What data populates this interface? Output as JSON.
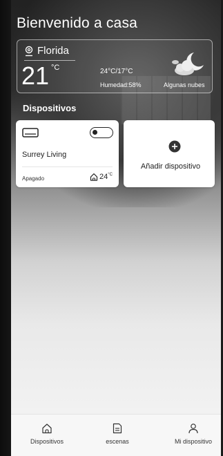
{
  "header": {
    "title": "Bienvenido a casa"
  },
  "weather": {
    "location": "Florida",
    "temperature": "21",
    "temperature_unit": "°C",
    "range": "24°C/17°C",
    "humidity": "Humedad:58%",
    "condition": "Algunas nubes",
    "location_icon": "location-pin-icon",
    "condition_icon": "partly-cloudy-night-icon"
  },
  "devices_section": {
    "label": "Dispositivos"
  },
  "devices": [
    {
      "name": "Surrey Living",
      "status": "Apagado",
      "temperature": "24",
      "temperature_unit": "°C",
      "icon": "air-conditioner-icon",
      "power_on": false
    }
  ],
  "add_device": {
    "label": "Añadir dispositivo",
    "icon": "plus-circle-icon"
  },
  "bottom_nav": {
    "items": [
      {
        "label": "Dispositivos",
        "icon": "home-outline-icon"
      },
      {
        "label": "escenas",
        "icon": "scenes-document-icon"
      },
      {
        "label": "Mi dispositivo",
        "icon": "user-outline-icon"
      }
    ]
  }
}
